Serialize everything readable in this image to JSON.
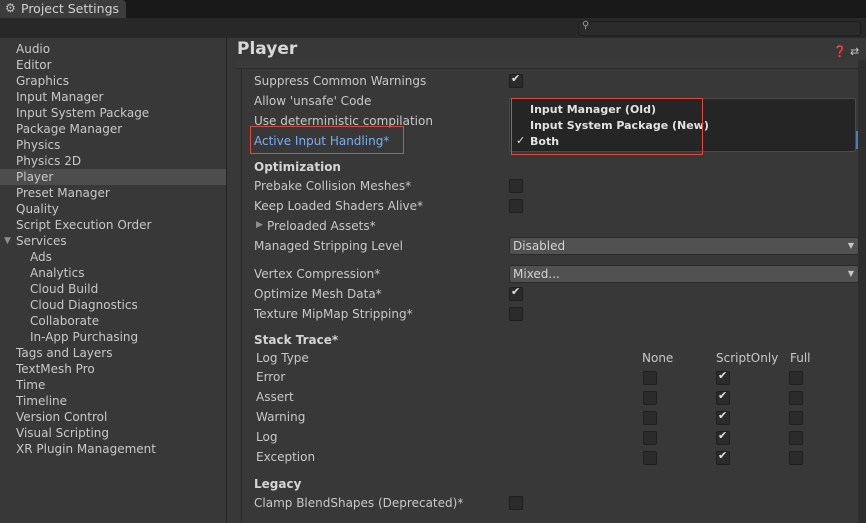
{
  "window": {
    "title": "Project Settings",
    "gear_icon": "gear-icon",
    "search_icon": "search-icon"
  },
  "sidebar": {
    "items": [
      {
        "label": "Audio"
      },
      {
        "label": "Editor"
      },
      {
        "label": "Graphics"
      },
      {
        "label": "Input Manager"
      },
      {
        "label": "Input System Package"
      },
      {
        "label": "Package Manager"
      },
      {
        "label": "Physics"
      },
      {
        "label": "Physics 2D"
      },
      {
        "label": "Player",
        "selected": true
      },
      {
        "label": "Preset Manager"
      },
      {
        "label": "Quality"
      },
      {
        "label": "Script Execution Order"
      },
      {
        "label": "Services",
        "expanded": true
      },
      {
        "label": "Ads"
      },
      {
        "label": "Analytics"
      },
      {
        "label": "Cloud Build"
      },
      {
        "label": "Cloud Diagnostics"
      },
      {
        "label": "Collaborate"
      },
      {
        "label": "In-App Purchasing"
      },
      {
        "label": "Tags and Layers"
      },
      {
        "label": "TextMesh Pro"
      },
      {
        "label": "Time"
      },
      {
        "label": "Timeline"
      },
      {
        "label": "Version Control"
      },
      {
        "label": "Visual Scripting"
      },
      {
        "label": "XR Plugin Management"
      }
    ]
  },
  "main": {
    "title": "Player",
    "help_icon": "help-icon",
    "settings_icon": "preset-icon",
    "rows": {
      "suppress_warnings": {
        "label": "Suppress Common Warnings",
        "checked": true
      },
      "allow_unsafe": {
        "label": "Allow 'unsafe' Code"
      },
      "deterministic": {
        "label": "Use deterministic compilation"
      },
      "active_input": {
        "label": "Active Input Handling*"
      }
    },
    "optimization": {
      "header": "Optimization",
      "prebake": {
        "label": "Prebake Collision Meshes*",
        "checked": false
      },
      "keep_shaders": {
        "label": "Keep Loaded Shaders Alive*",
        "checked": false
      },
      "preloaded": {
        "label": "Preloaded Assets*"
      },
      "stripping": {
        "label": "Managed Stripping Level",
        "value": "Disabled"
      },
      "vertex_comp": {
        "label": "Vertex Compression*",
        "value": "Mixed..."
      },
      "optimize_mesh": {
        "label": "Optimize Mesh Data*",
        "checked": true
      },
      "mipmap": {
        "label": "Texture MipMap Stripping*",
        "checked": false
      }
    },
    "stack_trace": {
      "header": "Stack Trace*",
      "col_log_type": "Log Type",
      "col_none": "None",
      "col_script": "ScriptOnly",
      "col_full": "Full",
      "rows": [
        {
          "label": "Error",
          "none": false,
          "script": true,
          "full": false
        },
        {
          "label": "Assert",
          "none": false,
          "script": true,
          "full": false
        },
        {
          "label": "Warning",
          "none": false,
          "script": true,
          "full": false
        },
        {
          "label": "Log",
          "none": false,
          "script": true,
          "full": false
        },
        {
          "label": "Exception",
          "none": false,
          "script": true,
          "full": false
        }
      ]
    },
    "legacy": {
      "header": "Legacy",
      "clamp": {
        "label": "Clamp BlendShapes (Deprecated)*",
        "checked": false
      }
    }
  },
  "popup": {
    "options": [
      {
        "label": "Input Manager (Old)",
        "selected": false
      },
      {
        "label": "Input System Package (New)",
        "selected": false
      },
      {
        "label": "Both",
        "selected": true
      }
    ],
    "check_glyph": "✓"
  },
  "colors": {
    "highlight_red": "#e04a3c",
    "link_blue": "#7aaef0"
  }
}
